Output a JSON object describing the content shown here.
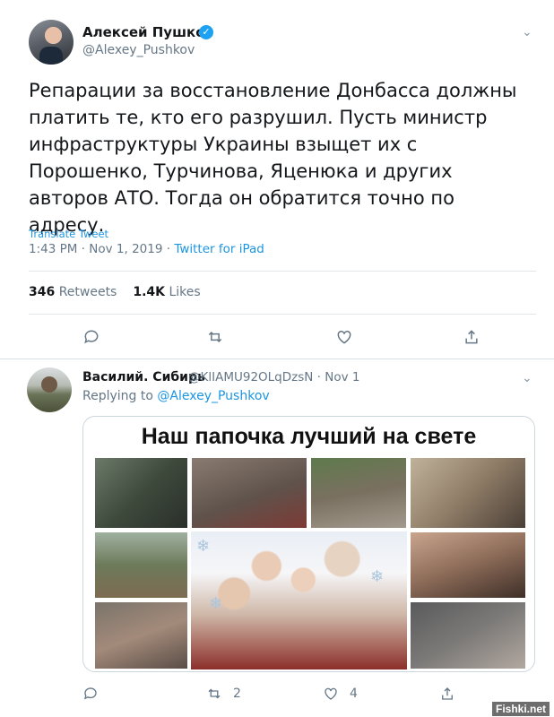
{
  "main_tweet": {
    "author_name": "Алексей Пушков",
    "author_handle": "@Alexey_Pushkov",
    "text": "Репарации за восстановление Донбасса должны платить те, кто его разрушил. Пусть министр инфраструктуры Украины взыщет их с Порошенко, Турчинова, Яценюка и других авторов АТО. Тогда он обратится точно по адресу.",
    "translate_label": "Translate Tweet",
    "time": "1:43 PM · Nov 1, 2019 · ",
    "source": "Twitter for iPad",
    "retweets_count": "346",
    "retweets_label": "Retweets",
    "likes_count": "1.4K",
    "likes_label": "Likes",
    "icons": [
      "reply-icon",
      "retweet-icon",
      "like-icon",
      "share-icon"
    ]
  },
  "reply_tweet": {
    "author_name": "Василий. Сибирь",
    "author_handle": "@KlIAMU92OLqDzsN · Nov 1",
    "replying_prefix": "Replying to ",
    "replying_handle": "@Alexey_Pushkov",
    "media_caption": "Наш папочка лучший на свете",
    "retweet_count": "2",
    "like_count": "4"
  },
  "watermark": "Fishki.net",
  "colors": {
    "link": "#1b95e0",
    "secondary_text": "#657786",
    "verified": "#1da1f2"
  }
}
